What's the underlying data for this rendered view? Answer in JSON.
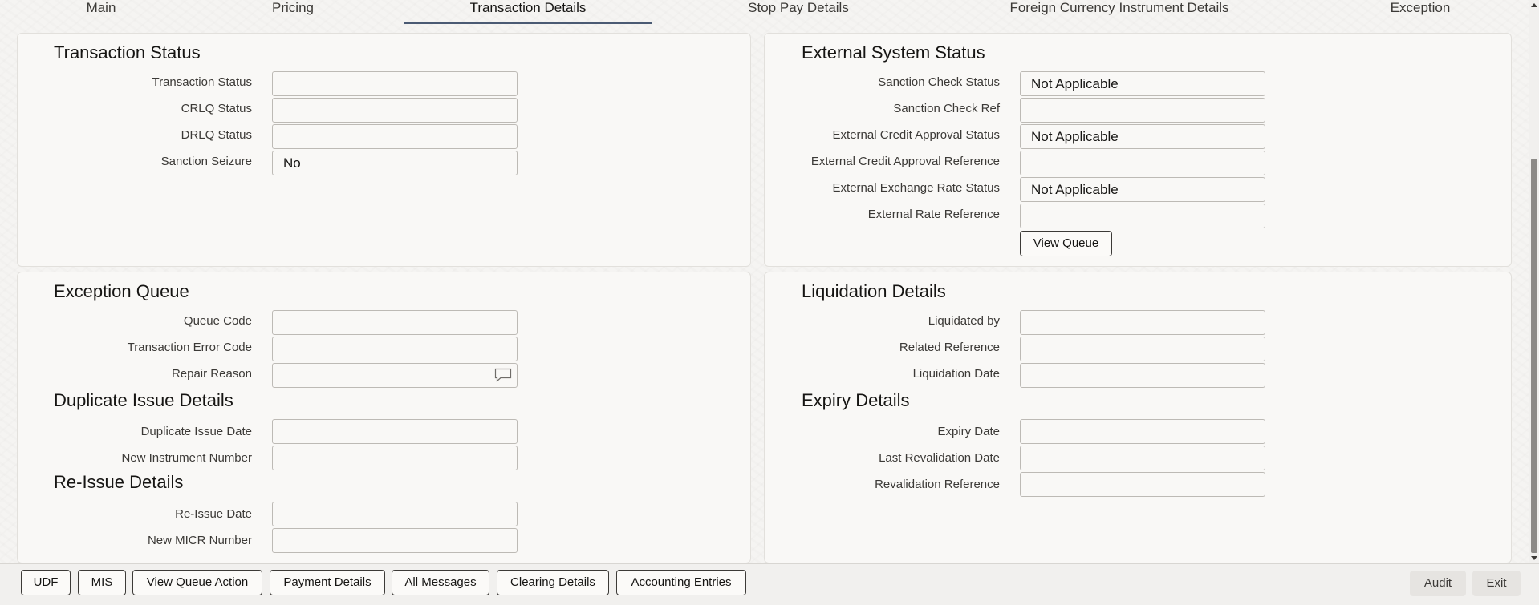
{
  "tabs": [
    {
      "label": "Main"
    },
    {
      "label": "Pricing"
    },
    {
      "label": "Transaction Details"
    },
    {
      "label": "Stop Pay Details"
    },
    {
      "label": "Foreign Currency Instrument Details"
    },
    {
      "label": "Exception"
    }
  ],
  "transaction_status": {
    "title": "Transaction Status",
    "fields": [
      {
        "label": "Transaction Status",
        "value": ""
      },
      {
        "label": "CRLQ Status",
        "value": ""
      },
      {
        "label": "DRLQ Status",
        "value": ""
      },
      {
        "label": "Sanction Seizure",
        "value": "No"
      }
    ]
  },
  "external_system_status": {
    "title": "External System Status",
    "fields": [
      {
        "label": "Sanction Check Status",
        "value": "Not Applicable"
      },
      {
        "label": "Sanction Check Ref",
        "value": ""
      },
      {
        "label": "External Credit Approval Status",
        "value": "Not Applicable"
      },
      {
        "label": "External Credit Approval Reference",
        "value": ""
      },
      {
        "label": "External Exchange Rate Status",
        "value": "Not Applicable"
      },
      {
        "label": "External Rate Reference",
        "value": ""
      }
    ],
    "view_queue_label": "View Queue"
  },
  "exception_queue": {
    "title": "Exception Queue",
    "fields": [
      {
        "label": "Queue Code",
        "value": ""
      },
      {
        "label": "Transaction Error Code",
        "value": ""
      },
      {
        "label": "Repair Reason",
        "value": ""
      }
    ]
  },
  "duplicate_issue": {
    "title": "Duplicate Issue Details",
    "fields": [
      {
        "label": "Duplicate Issue Date",
        "value": ""
      },
      {
        "label": "New Instrument Number",
        "value": ""
      }
    ]
  },
  "reissue": {
    "title": "Re-Issue Details",
    "fields": [
      {
        "label": "Re-Issue Date",
        "value": ""
      },
      {
        "label": "New MICR Number",
        "value": ""
      }
    ]
  },
  "liquidation": {
    "title": "Liquidation Details",
    "fields": [
      {
        "label": "Liquidated by",
        "value": ""
      },
      {
        "label": "Related Reference",
        "value": ""
      },
      {
        "label": "Liquidation Date",
        "value": ""
      }
    ]
  },
  "expiry": {
    "title": "Expiry Details",
    "fields": [
      {
        "label": "Expiry Date",
        "value": ""
      },
      {
        "label": "Last Revalidation Date",
        "value": ""
      },
      {
        "label": "Revalidation Reference",
        "value": ""
      }
    ]
  },
  "footer": {
    "buttons": [
      "UDF",
      "MIS",
      "View Queue Action",
      "Payment Details",
      "All Messages",
      "Clearing Details",
      "Accounting Entries"
    ],
    "audit_label": "Audit",
    "exit_label": "Exit"
  },
  "icons": {
    "repair_reason": "comment-icon"
  },
  "colors": {
    "active_tab_underline": "#4a5a73"
  }
}
